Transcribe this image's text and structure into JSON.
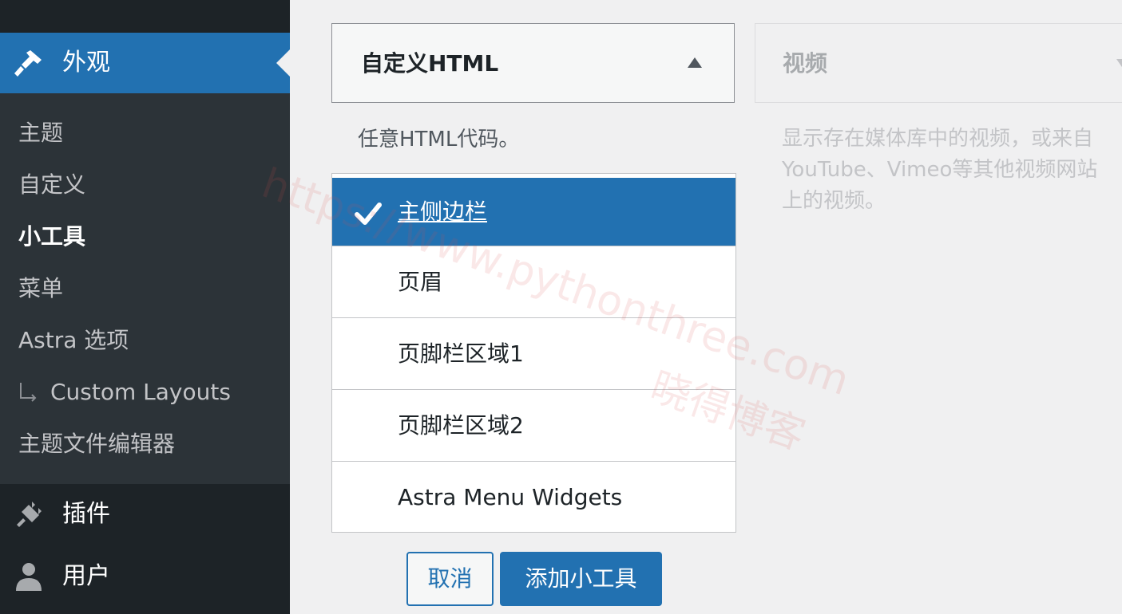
{
  "sidebar": {
    "appearance_label": "外观",
    "submenu": [
      "主题",
      "自定义",
      "小工具",
      "菜单",
      "Astra 选项",
      "Custom Layouts",
      "主题文件编辑器"
    ],
    "current_submenu": "小工具",
    "plugins_label": "插件",
    "users_label": "用户"
  },
  "widget": {
    "title": "自定义HTML",
    "description": "任意HTML代码。",
    "areas": [
      "主侧边栏",
      "页眉",
      "页脚栏区域1",
      "页脚栏区域2",
      "Astra Menu Widgets"
    ],
    "selected_area": "主侧边栏",
    "cancel_label": "取消",
    "add_label": "添加小工具"
  },
  "next_widget": {
    "title": "视频",
    "description_lines": [
      "显示存在媒体库中的视频，或来自",
      "YouTube、Vimeo等其他视频网站",
      "上的视频。"
    ]
  },
  "watermark": {
    "url": "https://www.pythonthree.com",
    "name": "晓得博客"
  },
  "colors": {
    "accent": "#2271b1",
    "sidebar_bg": "#1d2327",
    "submenu_bg": "#2c3338",
    "page_bg": "#f0f0f1"
  },
  "icons": [
    "paint-brush-icon",
    "plugin-icon",
    "user-icon",
    "checkmark-icon",
    "caret-up-icon",
    "caret-down-icon",
    "submenu-arrow-icon"
  ]
}
